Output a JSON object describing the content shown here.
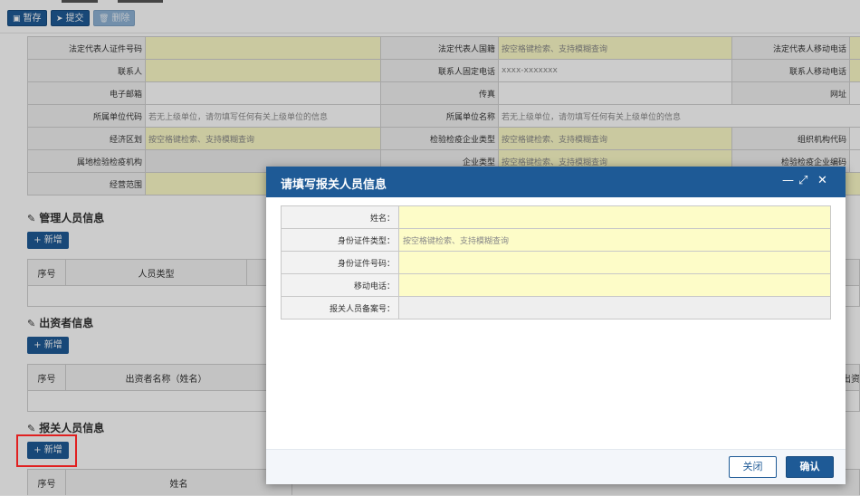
{
  "toolbar": {
    "save_label": "暂存",
    "submit_label": "提交",
    "delete_label": "删除"
  },
  "form": {
    "row1": {
      "l1": "法定代表人证件号码",
      "v1": "",
      "l2": "法定代表人国籍",
      "v2": "按空格键检索、支持模糊查询",
      "l3": "法定代表人移动电话",
      "v3": ""
    },
    "row2": {
      "l1": "联系人",
      "v1": "",
      "l2": "联系人固定电话",
      "v2": "xxxx-xxxxxxx",
      "l3": "联系人移动电话",
      "v3": ""
    },
    "row3": {
      "l1": "电子邮箱",
      "v1": "",
      "l2": "传真",
      "v2": "",
      "l3": "网址",
      "v3": ""
    },
    "row4": {
      "l1": "所属单位代码",
      "v1": "若无上级单位，请勿填写任何有关上级单位的信息",
      "l2": "所属单位名称",
      "v2": "若无上级单位，请勿填写任何有关上级单位的信息"
    },
    "row5": {
      "l1": "经济区划",
      "v1": "按空格键检索、支持模糊查询",
      "l2": "检验检疫企业类型",
      "v2": "按空格键检索、支持模糊查询",
      "l3": "组织机构代码",
      "v3": ""
    },
    "row6": {
      "l1": "属地检验检疫机构",
      "v1": "",
      "l2": "企业类型",
      "v2": "按空格键检索、支持模糊查询",
      "l3": "检验检疫企业编码",
      "v3": ""
    },
    "row7": {
      "l1": "经营范围",
      "v1": ""
    }
  },
  "sections": {
    "management": {
      "title": "管理人员信息",
      "add_label": "+ 新增",
      "col_no": "序号",
      "col_type": "人员类型"
    },
    "investors": {
      "title": "出资者信息",
      "add_label": "+ 新增",
      "col_no": "序号",
      "col_name": "出资者名称（姓名）",
      "col_trunc": "出资"
    },
    "declarants": {
      "title": "报关人员信息",
      "add_label": "+ 新增",
      "col_no": "序号",
      "col_name": "姓名"
    }
  },
  "modal": {
    "title": "请填写报关人员信息",
    "fields": [
      {
        "label": "姓名：",
        "value": ""
      },
      {
        "label": "身份证件类型：",
        "value": "按空格键检索、支持模糊查询"
      },
      {
        "label": "身份证件号码：",
        "value": ""
      },
      {
        "label": "移动电话：",
        "value": ""
      },
      {
        "label": "报关人员备案号：",
        "value": ""
      }
    ],
    "close_label": "关闭",
    "confirm_label": "确认"
  }
}
